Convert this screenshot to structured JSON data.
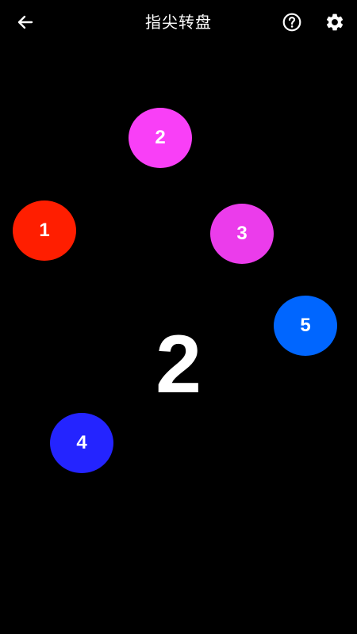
{
  "header": {
    "title": "指尖转盘",
    "back_icon": "arrow-left-icon",
    "help_icon": "help-circle-icon",
    "settings_icon": "gear-icon"
  },
  "fingers": [
    {
      "label": "1",
      "color": "#ff1e00"
    },
    {
      "label": "2",
      "color": "#f93ff7"
    },
    {
      "label": "3",
      "color": "#eb3ceb"
    },
    {
      "label": "4",
      "color": "#2424ff"
    },
    {
      "label": "5",
      "color": "#0066ff"
    }
  ],
  "result": {
    "value": "2"
  },
  "colors": {
    "background": "#000000",
    "foreground": "#ffffff"
  }
}
